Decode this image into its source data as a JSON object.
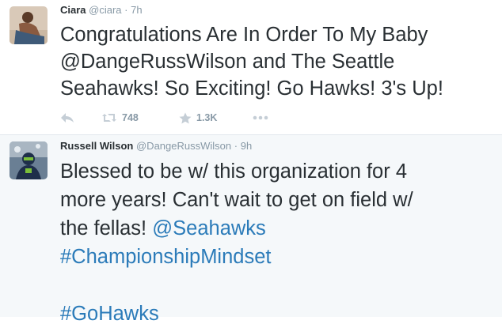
{
  "tweets": [
    {
      "name": "Ciara",
      "handle": "@ciara",
      "separator": "·",
      "time": "7h",
      "lines": [
        "Congratulations Are In Order To My Baby",
        "@DangeRussWilson and The Seattle",
        "Seahawks! So Exciting! Go Hawks! 3's Up!"
      ],
      "actions": {
        "reply_icon": "reply-icon",
        "retweet_icon": "retweet-icon",
        "retweet_count": "748",
        "favorite_icon": "star-icon",
        "favorite_count": "1.3K",
        "more_icon": "more-icon"
      }
    },
    {
      "name": "Russell Wilson",
      "handle": "@DangeRussWilson",
      "separator": "·",
      "time": "9h",
      "lines": [
        "Blessed to be w/ this organization for 4",
        "more years! Can't wait to get on field w/",
        "the fellas!",
        "@Seahawks",
        "#ChampionshipMindset",
        "#GoHawks"
      ]
    }
  ],
  "colors": {
    "link": "#2b7bb9",
    "meta": "#8899a6",
    "text": "#292f33",
    "highlight_bg": "#f5f8fa"
  }
}
